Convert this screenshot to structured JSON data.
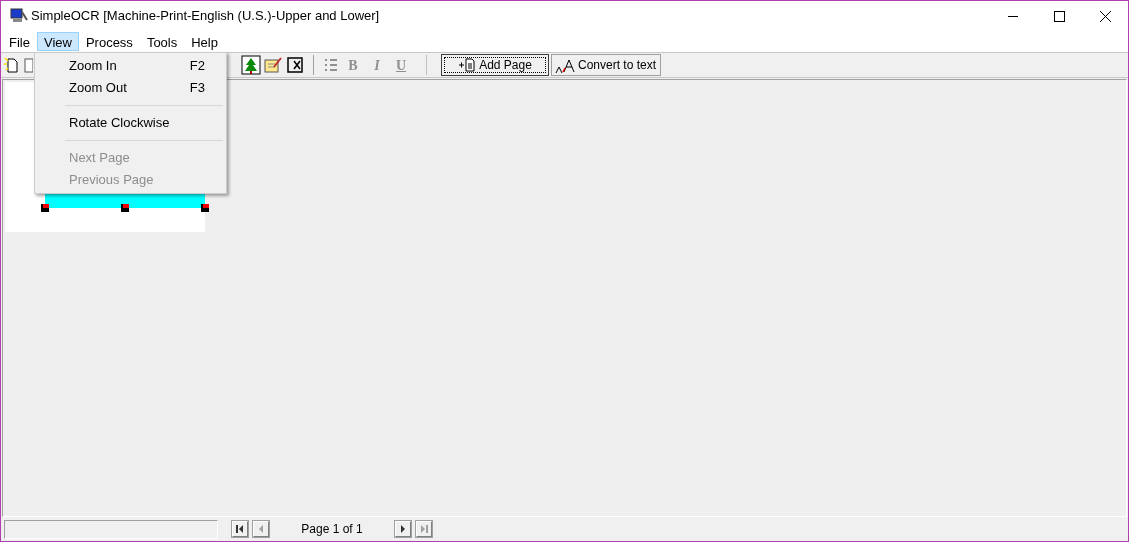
{
  "window": {
    "title": "SimpleOCR [Machine-Print-English (U.S.)-Upper and Lower]"
  },
  "menu_bar": [
    {
      "label": "File",
      "selected": false
    },
    {
      "label": "View",
      "selected": true
    },
    {
      "label": "Process",
      "selected": false
    },
    {
      "label": "Tools",
      "selected": false
    },
    {
      "label": "Help",
      "selected": false
    }
  ],
  "view_menu": [
    {
      "kind": "item",
      "label": "Zoom In",
      "shortcut": "F2",
      "disabled": false
    },
    {
      "kind": "item",
      "label": "Zoom Out",
      "shortcut": "F3",
      "disabled": false
    },
    {
      "kind": "separator"
    },
    {
      "kind": "item",
      "label": "Rotate Clockwise",
      "disabled": false
    },
    {
      "kind": "separator"
    },
    {
      "kind": "item",
      "label": "Next Page",
      "disabled": true
    },
    {
      "kind": "item",
      "label": "Previous Page",
      "disabled": true
    }
  ],
  "format_buttons": [
    {
      "label": "B",
      "kind": "bold",
      "disabled": true
    },
    {
      "label": "I",
      "kind": "italic",
      "disabled": true
    },
    {
      "label": "U",
      "kind": "underline",
      "disabled": true
    }
  ],
  "buttons": [
    {
      "label": "Add Page",
      "kind": "add",
      "focused": true
    },
    {
      "label": "Convert to text",
      "kind": "convert",
      "focused": false
    }
  ],
  "status_bar": {
    "page": "Page 1 of 1",
    "nav": [
      {
        "kind": "first",
        "disabled": false
      },
      {
        "kind": "prev",
        "disabled": true
      },
      {
        "kind": "next",
        "disabled": false
      },
      {
        "kind": "last",
        "disabled": true
      }
    ]
  }
}
